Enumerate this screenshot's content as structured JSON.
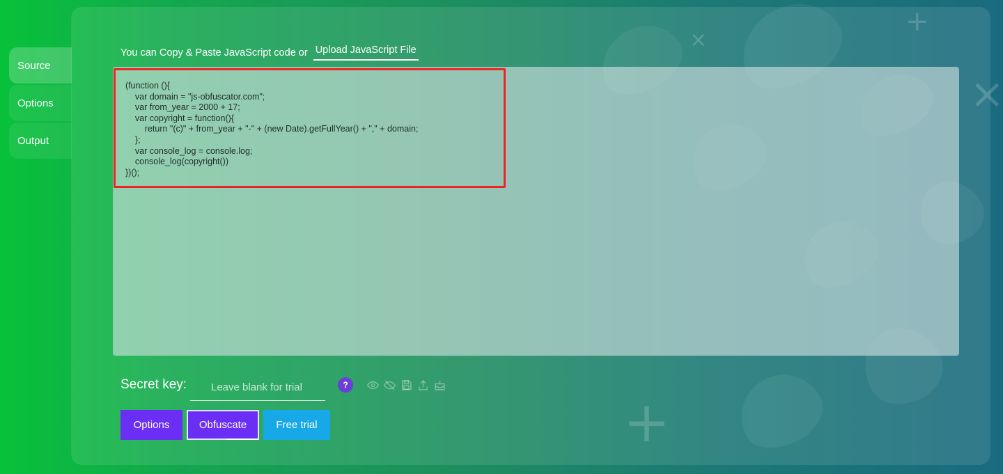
{
  "tabs": [
    {
      "label": "Source",
      "active": true
    },
    {
      "label": "Options",
      "active": false
    },
    {
      "label": "Output",
      "active": false
    }
  ],
  "intro": {
    "text": "You can Copy & Paste JavaScript code or",
    "upload_label": "Upload JavaScript File"
  },
  "editor": {
    "code": "(function (){\n    var domain = \"js-obfuscator.com\";\n    var from_year = 2000 + 17;\n    var copyright = function(){\n        return \"(c)\" + from_year + \"-\" + (new Date).getFullYear() + \",\" + domain;\n    };\n    var console_log = console.log;\n    console_log(copyright())\n})();"
  },
  "secret": {
    "label": "Secret key:",
    "placeholder": "Leave blank for trial",
    "help": "?"
  },
  "tool_icons": [
    "eye-icon",
    "eye-off-icon",
    "save-icon",
    "upload-icon",
    "inbox-icon"
  ],
  "buttons": {
    "options": "Options",
    "obfuscate": "Obfuscate",
    "free_trial": "Free trial"
  },
  "colors": {
    "highlight_border": "#ee2424",
    "primary_button": "#6b2ef5",
    "trial_button": "#17a8e8",
    "help_badge": "#6a3fd8"
  }
}
